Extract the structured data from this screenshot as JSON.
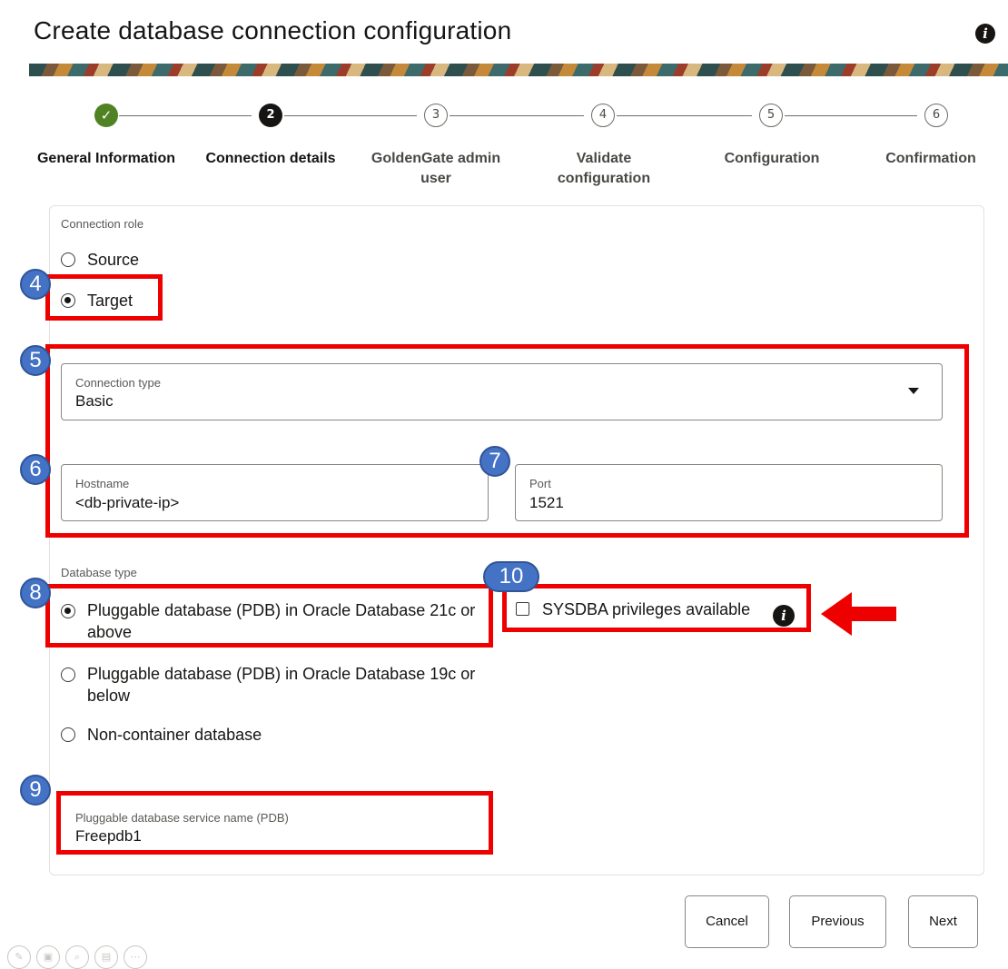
{
  "header": {
    "title": "Create database connection configuration",
    "info_icon": "info-icon"
  },
  "stepper": {
    "steps": [
      {
        "number": "✓",
        "label": "General Information",
        "state": "done"
      },
      {
        "number": "2",
        "label": "Connection details",
        "state": "current"
      },
      {
        "number": "3",
        "label": "GoldenGate admin user",
        "state": "todo"
      },
      {
        "number": "4",
        "label": "Validate configuration",
        "state": "todo"
      },
      {
        "number": "5",
        "label": "Configuration",
        "state": "todo"
      },
      {
        "number": "6",
        "label": "Confirmation",
        "state": "todo"
      }
    ]
  },
  "form": {
    "connection_role": {
      "label": "Connection role",
      "options": [
        {
          "label": "Source",
          "selected": false
        },
        {
          "label": "Target",
          "selected": true
        }
      ]
    },
    "connection_type": {
      "label": "Connection type",
      "value": "Basic"
    },
    "hostname": {
      "label": "Hostname",
      "value": "<db-private-ip>"
    },
    "port": {
      "label": "Port",
      "value": "1521"
    },
    "database_type": {
      "label": "Database type",
      "options": [
        {
          "label": "Pluggable database (PDB) in Oracle Database 21c or above",
          "selected": true
        },
        {
          "label": "Pluggable database (PDB) in Oracle Database 19c or below",
          "selected": false
        },
        {
          "label": "Non-container database",
          "selected": false
        }
      ]
    },
    "sysdba": {
      "label": "SYSDBA privileges available",
      "checked": false
    },
    "pdb_service": {
      "label": "Pluggable database service name (PDB)",
      "value": "Freepdb1"
    }
  },
  "buttons": {
    "cancel": "Cancel",
    "previous": "Previous",
    "next": "Next"
  },
  "annotations": {
    "badges": [
      "4",
      "5",
      "6",
      "7",
      "8",
      "9",
      "10"
    ],
    "highlight_color": "#ee0000",
    "badge_color": "#4472c4"
  },
  "colors": {
    "success": "#508223",
    "text": "#161513"
  }
}
